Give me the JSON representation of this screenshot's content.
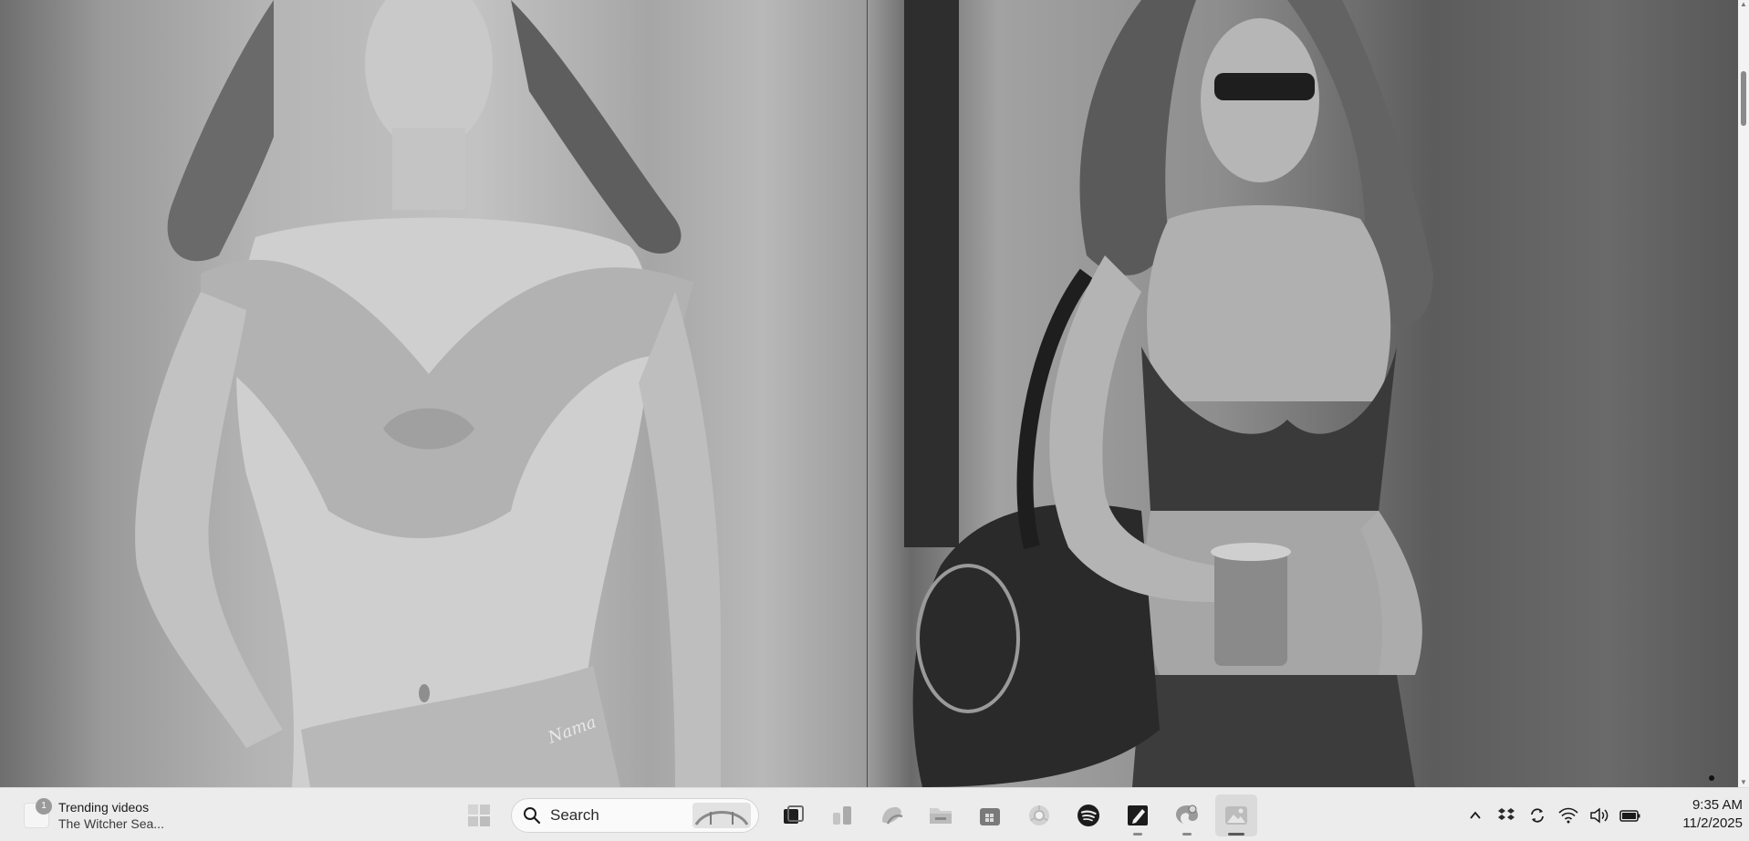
{
  "viewer": {
    "left_image": "photo-left",
    "right_image": "photo-right",
    "left_watermark": "Nama"
  },
  "taskbar": {
    "widget": {
      "badge": "1",
      "title": "Trending videos",
      "subtitle": "The Witcher Sea..."
    },
    "search": {
      "label": "Search"
    },
    "apps": [
      {
        "name": "start-icon",
        "active": false
      },
      {
        "name": "task-view-icon",
        "active": false
      },
      {
        "name": "widgets-icon",
        "active": false
      },
      {
        "name": "copilot-icon",
        "active": false
      },
      {
        "name": "file-explorer-icon",
        "active": false
      },
      {
        "name": "microsoft-store-icon",
        "active": false
      },
      {
        "name": "chrome-icon",
        "active": false
      },
      {
        "name": "spotify-icon",
        "active": false
      },
      {
        "name": "notes-app-icon",
        "active": false,
        "running": true
      },
      {
        "name": "edge-browser-icon",
        "active": false,
        "running": true
      },
      {
        "name": "photos-app-icon",
        "active": true,
        "running": true
      }
    ],
    "tray": {
      "icons": [
        "chevron-up-icon",
        "dropbox-icon",
        "sync-icon",
        "wifi-icon",
        "volume-icon",
        "battery-icon"
      ]
    },
    "clock": {
      "time": "9:35 AM",
      "date": "11/2/2025"
    }
  },
  "colors": {
    "taskbar_bg": "#ececec",
    "viewer_bg": "#8a8a8a",
    "active_app_bg": "#dadada"
  }
}
